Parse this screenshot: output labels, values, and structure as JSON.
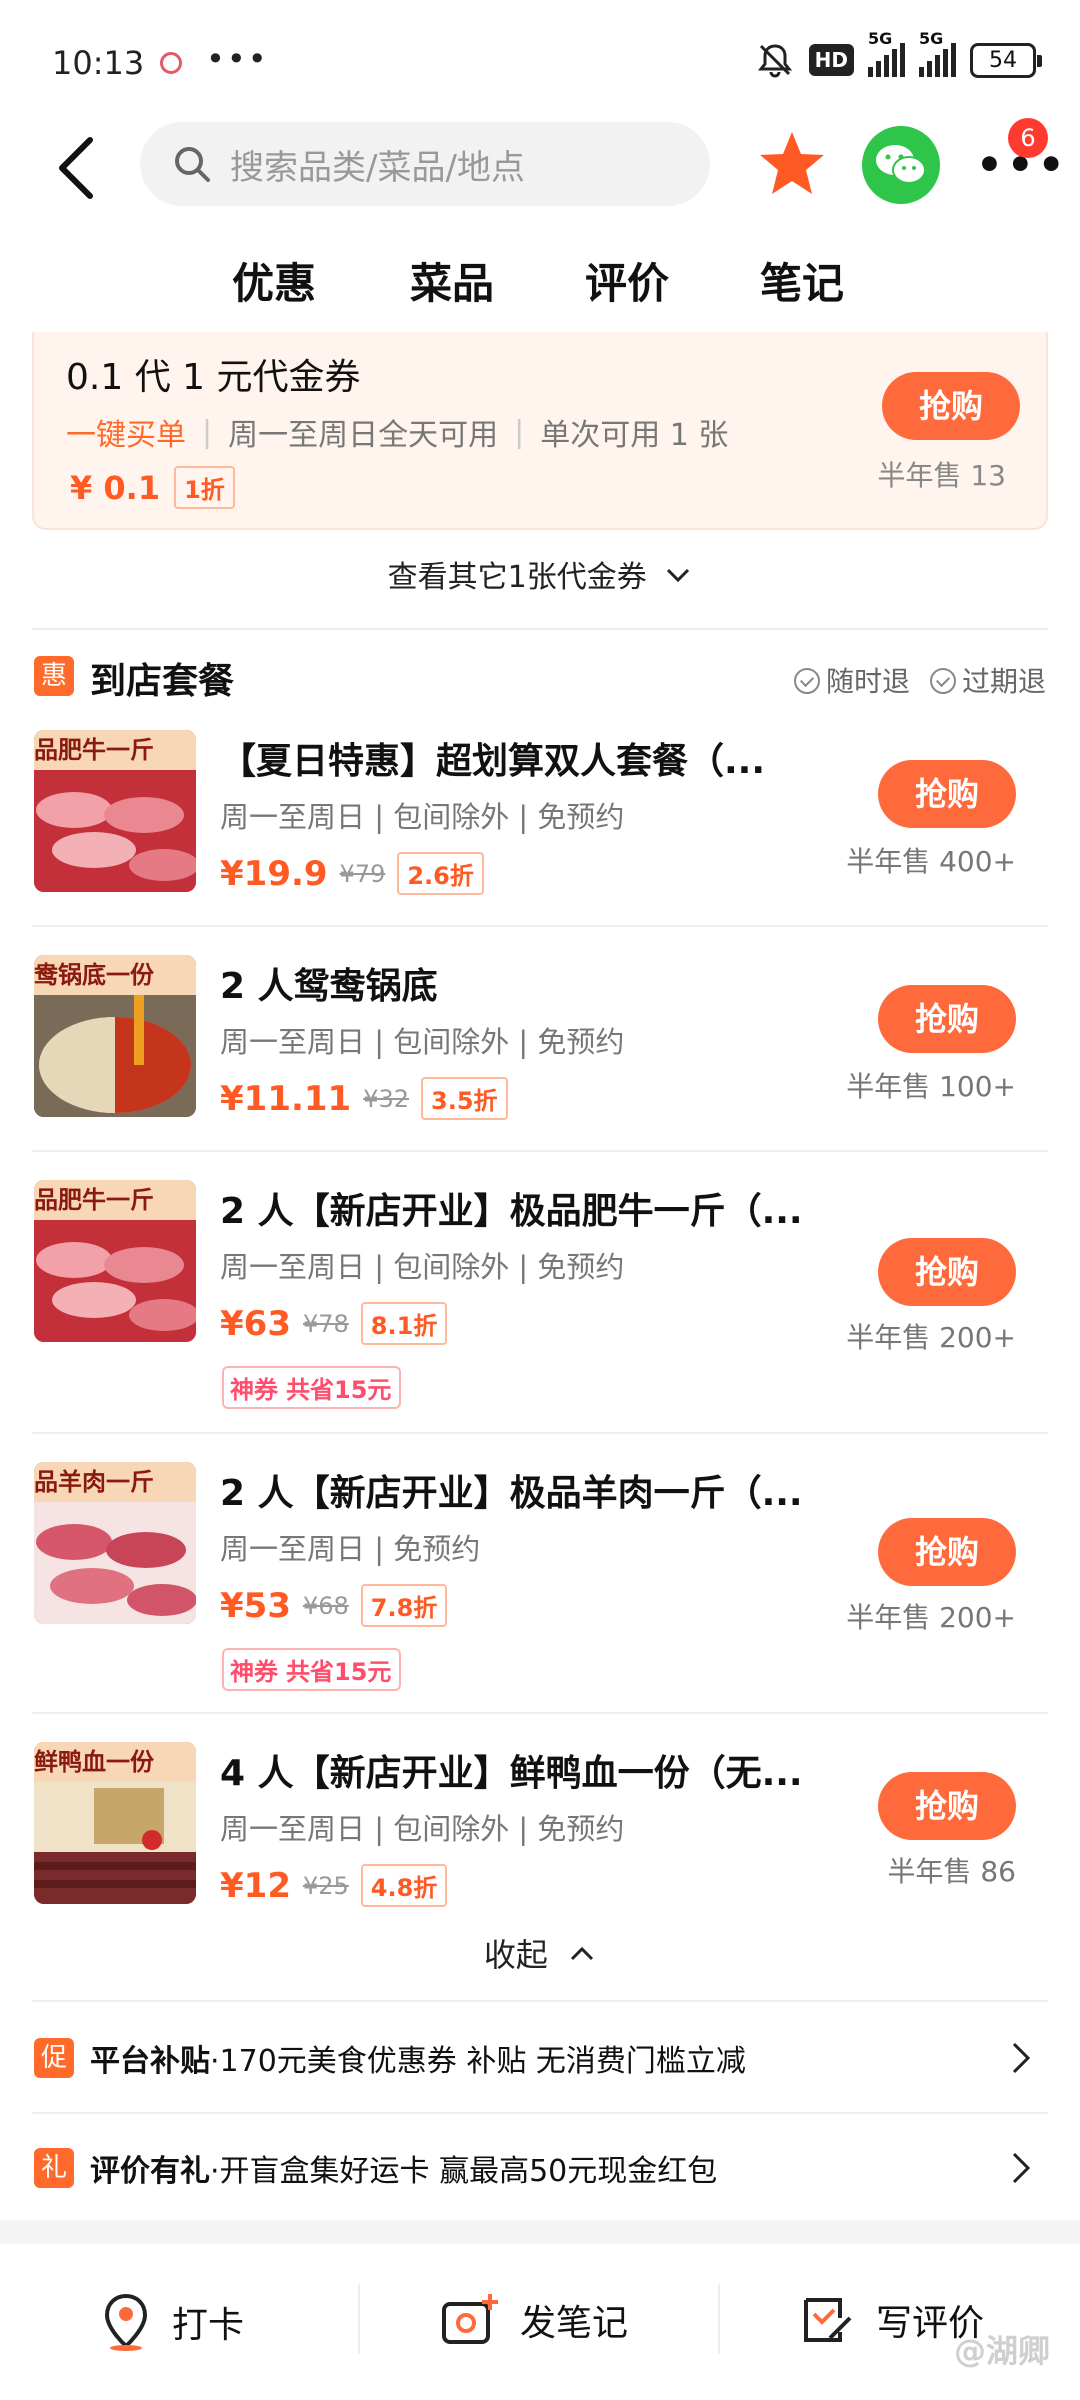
{
  "status_bar": {
    "time": "10:13",
    "net_hd": "HD",
    "net1": "5G",
    "net2": "5G",
    "battery": "54"
  },
  "header": {
    "search_placeholder": "搜索品类/菜品/地点",
    "notif_count": "6"
  },
  "tabs": [
    "优惠",
    "菜品",
    "评价",
    "笔记"
  ],
  "voucher": {
    "title": "0.1 代 1 元代金券",
    "tag": "一键买单",
    "avail": "周一至周日全天可用",
    "limit": "单次可用 1 张",
    "price": "¥ 0.1",
    "discount": "1折",
    "buy_label": "抢购",
    "sold": "半年售 13"
  },
  "more_vouchers": "查看其它1张代金券",
  "section": {
    "icon_text": "惠",
    "title": "到店套餐",
    "policy1": "随时退",
    "policy2": "过期退"
  },
  "deals": [
    {
      "thumb_text": "品肥牛一斤",
      "name": "【夏日特惠】超划算双人套餐（...",
      "desc": "周一至周日 | 包间除外 | 免预约",
      "price": "¥19.9",
      "orig": "¥79",
      "discount": "2.6折",
      "buy": "抢购",
      "sold": "半年售 400+"
    },
    {
      "thumb_text": "鸯锅底一份",
      "name": "2 人鸳鸯锅底",
      "desc": "周一至周日 | 包间除外 | 免预约",
      "price": "¥11.11",
      "orig": "¥32",
      "discount": "3.5折",
      "buy": "抢购",
      "sold": "半年售 100+"
    },
    {
      "thumb_text": "品肥牛一斤",
      "name": "2 人【新店开业】极品肥牛一斤（...",
      "desc": "周一至周日 | 包间除外 | 免预约",
      "price": "¥63",
      "orig": "¥78",
      "discount": "8.1折",
      "coupon_a": "神券",
      "coupon_b": "共省15元",
      "buy": "抢购",
      "sold": "半年售 200+"
    },
    {
      "thumb_text": "品羊肉一斤",
      "name": "2 人【新店开业】极品羊肉一斤（...",
      "desc": "周一至周日 | 免预约",
      "price": "¥53",
      "orig": "¥68",
      "discount": "7.8折",
      "coupon_a": "神券",
      "coupon_b": "共省15元",
      "buy": "抢购",
      "sold": "半年售 200+"
    },
    {
      "thumb_text": "鲜鸭血一份",
      "name": "4 人【新店开业】鲜鸭血一份（无...",
      "desc": "周一至周日 | 包间除外 | 免预约",
      "price": "¥12",
      "orig": "¥25",
      "discount": "4.8折",
      "buy": "抢购",
      "sold": "半年售 86"
    }
  ],
  "collapse": "收起",
  "promos": [
    {
      "tag": "促",
      "title": "平台补贴",
      "text": "·170元美食优惠券 补贴 无消费门槛立减"
    },
    {
      "tag": "礼",
      "title": "评价有礼",
      "text": "·开盲盒集好运卡 赢最高50元现金红包"
    }
  ],
  "bottom": {
    "checkin": "打卡",
    "note": "发笔记",
    "review": "写评价"
  },
  "watermark": "@湖卿",
  "colors": {
    "accent": "#ff6a3d",
    "price": "#ff5a24",
    "wechat": "#2ec54a"
  }
}
